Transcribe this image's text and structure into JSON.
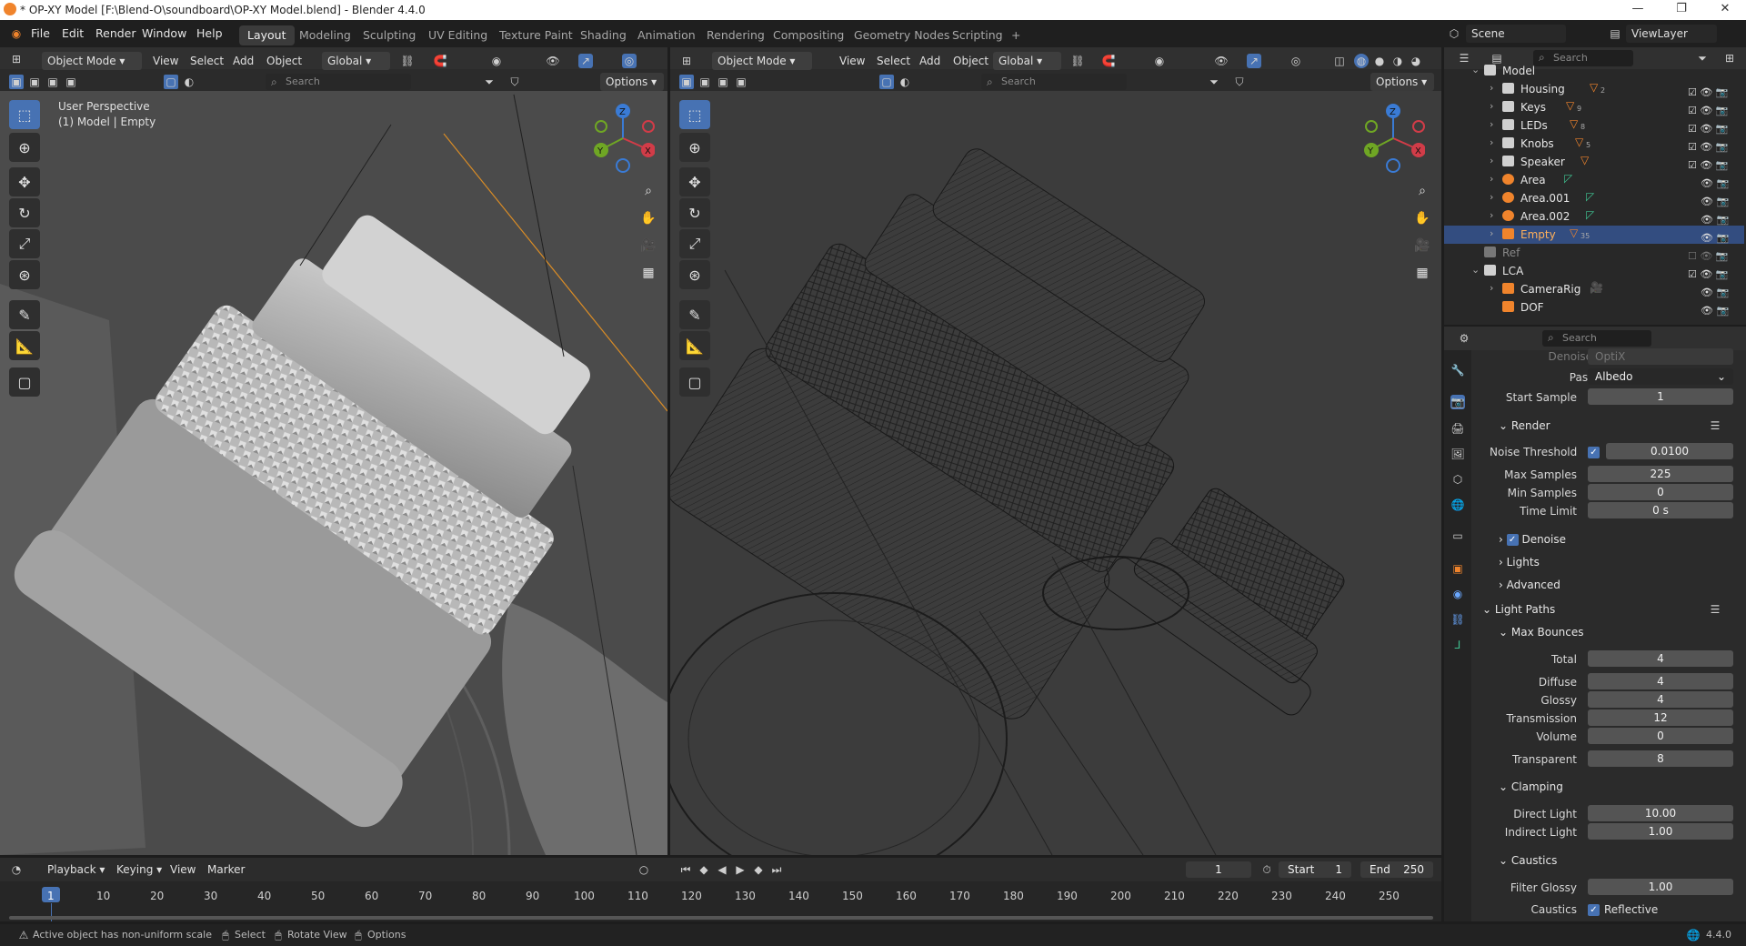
{
  "window": {
    "title": "* OP-XY Model [F:\\Blend-O\\soundboard\\OP-XY Model.blend] - Blender 4.4.0",
    "controls": [
      "—",
      "❐",
      "✕"
    ]
  },
  "menu": [
    "File",
    "Edit",
    "Render",
    "Window",
    "Help"
  ],
  "workspaces": [
    "Layout",
    "Modeling",
    "Sculpting",
    "UV Editing",
    "Texture Paint",
    "Shading",
    "Animation",
    "Rendering",
    "Compositing",
    "Geometry Nodes",
    "Scripting",
    "+"
  ],
  "scene": {
    "label": "Scene",
    "viewlayer": "ViewLayer"
  },
  "viewport_left": {
    "mode": "Object Mode",
    "menus": [
      "View",
      "Select",
      "Add",
      "Object"
    ],
    "orientation": "Global",
    "search_placeholder": "Search",
    "options": "Options",
    "overlay_line1": "User Perspective",
    "overlay_line2": "(1) Model | Empty"
  },
  "viewport_right": {
    "mode": "Object Mode",
    "menus": [
      "View",
      "Select",
      "Add",
      "Object"
    ],
    "orientation": "Global",
    "search_placeholder": "Search",
    "options": "Options"
  },
  "gizmo": {
    "x": "X",
    "y": "Y",
    "z": "Z"
  },
  "outliner": {
    "search_placeholder": "Search",
    "items": [
      {
        "name": "Model",
        "count": ""
      },
      {
        "name": "Housing",
        "count": "2"
      },
      {
        "name": "Keys",
        "count": "9"
      },
      {
        "name": "LEDs",
        "count": "8"
      },
      {
        "name": "Knobs",
        "count": "5"
      },
      {
        "name": "Speaker",
        "count": ""
      },
      {
        "name": "Area",
        "count": ""
      },
      {
        "name": "Area.001",
        "count": ""
      },
      {
        "name": "Area.002",
        "count": ""
      },
      {
        "name": "Empty",
        "count": "35"
      },
      {
        "name": "Ref",
        "count": ""
      },
      {
        "name": "LCA",
        "count": ""
      },
      {
        "name": "CameraRig",
        "count": ""
      },
      {
        "name": "DOF",
        "count": ""
      }
    ]
  },
  "properties": {
    "search_placeholder": "Search",
    "denoiser_label": "Denoiser",
    "denoiser_value": "OptiX",
    "passes_label": "Passes",
    "passes_value": "Albedo",
    "start_sample_label": "Start Sample",
    "start_sample_value": "1",
    "render_section": "Render",
    "noise_threshold_label": "Noise Threshold",
    "noise_threshold_value": "0.0100",
    "max_samples_label": "Max Samples",
    "max_samples_value": "225",
    "min_samples_label": "Min Samples",
    "min_samples_value": "0",
    "time_limit_label": "Time Limit",
    "time_limit_value": "0 s",
    "denoise": "Denoise",
    "lights": "Lights",
    "advanced": "Advanced",
    "light_paths": "Light Paths",
    "max_bounces": "Max Bounces",
    "total_label": "Total",
    "total_value": "4",
    "diffuse_label": "Diffuse",
    "diffuse_value": "4",
    "glossy_label": "Glossy",
    "glossy_value": "4",
    "transmission_label": "Transmission",
    "transmission_value": "12",
    "volume_label": "Volume",
    "volume_value": "0",
    "transparent_label": "Transparent",
    "transparent_value": "8",
    "clamping": "Clamping",
    "direct_light_label": "Direct Light",
    "direct_light_value": "10.00",
    "indirect_light_label": "Indirect Light",
    "indirect_light_value": "1.00",
    "caustics": "Caustics",
    "filter_glossy_label": "Filter Glossy",
    "filter_glossy_value": "1.00",
    "caustics_label": "Caustics",
    "reflective": "Reflective"
  },
  "timeline": {
    "menus": [
      "Playback",
      "Keying",
      "View",
      "Marker"
    ],
    "current": "1",
    "start_label": "Start",
    "start": "1",
    "end_label": "End",
    "end": "250",
    "frames": [
      "1",
      "10",
      "20",
      "30",
      "40",
      "50",
      "60",
      "70",
      "80",
      "90",
      "100",
      "110",
      "120",
      "130",
      "140",
      "150",
      "160",
      "170",
      "180",
      "190",
      "200",
      "210",
      "220",
      "230",
      "240",
      "250"
    ]
  },
  "statusbar": {
    "message": "Active object has non-uniform scale",
    "select": "Select",
    "rotate": "Rotate View",
    "options": "Options",
    "version": "4.4.0"
  }
}
